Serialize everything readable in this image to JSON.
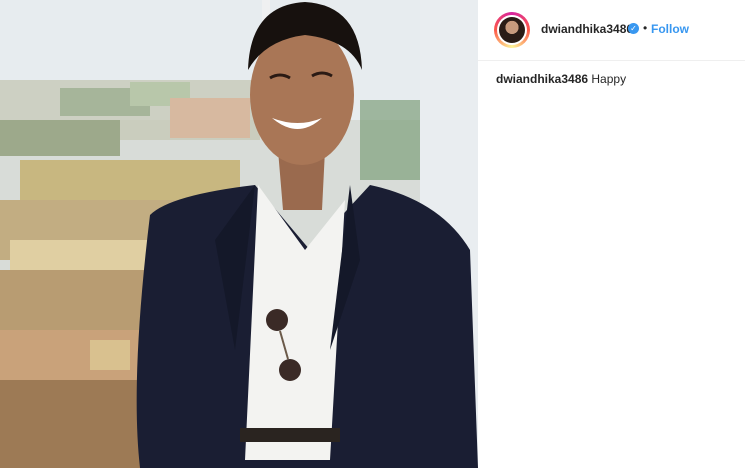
{
  "post": {
    "username": "dwiandhika3486",
    "verified_icon": "verified-badge-icon",
    "separator": "•",
    "follow_label": "Follow",
    "caption_user": "dwiandhika3486",
    "caption_text": "Happy"
  },
  "colors": {
    "link_blue": "#3897f0",
    "text": "#262626",
    "divider": "#efefef"
  }
}
